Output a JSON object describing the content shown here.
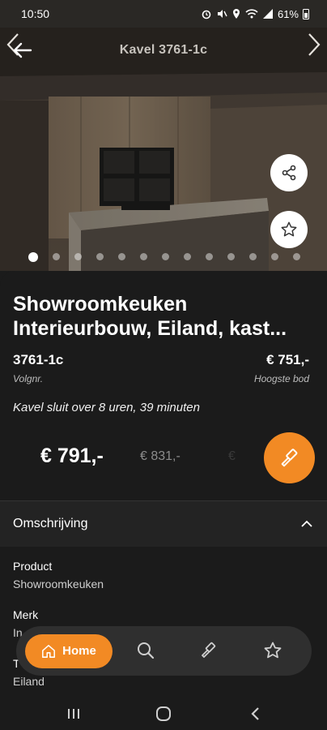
{
  "status": {
    "time": "10:50",
    "battery": "61%"
  },
  "header": {
    "title": "Kavel 3761-1c"
  },
  "gallery": {
    "image_count": 13,
    "active_index": 0
  },
  "lot": {
    "title_line1": "Showroomkeuken",
    "title_line2": "Interieurbouw, Eiland, kast...",
    "number": "3761-1c",
    "number_label": "Volgnr.",
    "highest_bid": "€ 751,-",
    "highest_bid_label": "Hoogste bod",
    "closing_text": "Kavel sluit over 8 uren, 39 minuten"
  },
  "bids": {
    "selected": "€ 791,-",
    "next": "€ 831,-",
    "faded": "€"
  },
  "description": {
    "section_title": "Omschrijving",
    "specs": [
      {
        "label": "Product",
        "value": "Showroomkeuken"
      },
      {
        "label": "Merk",
        "value": "In"
      },
      {
        "label": "T",
        "value": "Eiland"
      }
    ]
  },
  "bottom_nav": {
    "home_label": "Home",
    "items": [
      "search-icon",
      "gavel-icon",
      "star-icon"
    ]
  },
  "colors": {
    "accent": "#f28a24",
    "background": "#1b1b1b",
    "section": "#232323"
  }
}
